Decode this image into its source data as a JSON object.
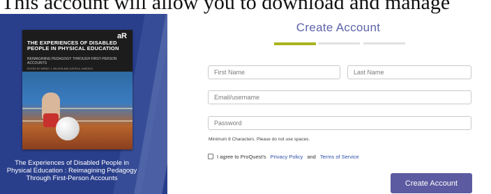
{
  "header": {
    "text": "This account will allow you to download and manage"
  },
  "book": {
    "publisher_logo": "aR",
    "cover_title": "THE EXPERIENCES OF DISABLED PEOPLE IN PHYSICAL EDUCATION",
    "cover_subtitle": "REIMAGINING PEDAGOGY THROUGH FIRST-PERSON ACCOUNTS",
    "cover_editors": "EDITED BY WENDY J. NELSON AND JUSTIN A. HAEGELE",
    "caption": "The Experiences of Disabled People in Physical Education : Reimagining Pedagogy Through First-Person Accounts"
  },
  "form": {
    "title": "Create Account",
    "progress_step": 1,
    "progress_total": 3,
    "first_name_placeholder": "First Name",
    "last_name_placeholder": "Last Name",
    "email_placeholder": "Email/username",
    "password_placeholder": "Password",
    "password_hint": "Minimum 8 Characters. Please do not use spaces.",
    "agree_prefix": "I agree to ProQuest's",
    "privacy_link": "Privacy Policy",
    "agree_and": "and",
    "terms_link": "Terms of Service",
    "submit_label": "Create Account"
  },
  "colors": {
    "panel": "#2a3f8c",
    "title": "#5d63a8",
    "progress_active": "#a9b321",
    "button": "#5c5aa0",
    "link": "#2d4fa8"
  }
}
